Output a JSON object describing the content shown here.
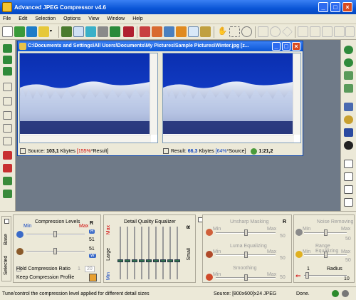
{
  "window": {
    "title": "Advanced JPEG Compressor v4.6"
  },
  "menu": [
    "File",
    "Edit",
    "Selection",
    "Options",
    "View",
    "Window",
    "Help"
  ],
  "image_window": {
    "title": "C:\\Documents and Settings\\All Users\\Documents\\My Pictures\\Sample Pictures\\Winter.jpg [z...",
    "source_label": "Source:",
    "source_size": "103,1",
    "source_unit": "Kbytes",
    "source_pct": "[155%",
    "source_suffix": "*Result]",
    "result_label": "Result:",
    "result_size": "66,3",
    "result_unit": "Kbytes",
    "result_pct": "[64%",
    "result_suffix": "*Source]",
    "ratio": "1:21,2"
  },
  "panel": {
    "base_label": "Base",
    "selected_label": "Selected",
    "compression_title": "Compression Levels",
    "min": "Min",
    "max": "Max",
    "r": "R",
    "level1": "51",
    "level2": "51",
    "box_h": "H",
    "box_w": "W",
    "hold_ratio": "Hold Compression Ratio",
    "ratio_a": "1",
    "ratio_b": "20",
    "keep_profile": "Keep Compression Profile",
    "eq_title": "Detail Quality Equalizer",
    "eq_large": "Large",
    "eq_small": "Small",
    "unsharp": "Unsharp Masking",
    "luma": "Luma Equalizing",
    "smoothing": "Smoothing",
    "noise": "Noise Removing",
    "range": "Range Equalizing",
    "radius": "Radius",
    "unsharp_val": "50",
    "luma_val": "50",
    "smoothing_val": "50",
    "noise_val": "50",
    "range_val": "50",
    "radius_min": "1",
    "radius_max": "10"
  },
  "status": {
    "hint": "Tune/control the compression level applied for different detail sizes",
    "source": "Source: [800x600]x24 JPEG",
    "done": "Done."
  },
  "colors": {
    "xp_blue": "#0a55d6",
    "face": "#ece9d8",
    "workspace": "#6f7a88",
    "accent_red": "#d00000"
  }
}
